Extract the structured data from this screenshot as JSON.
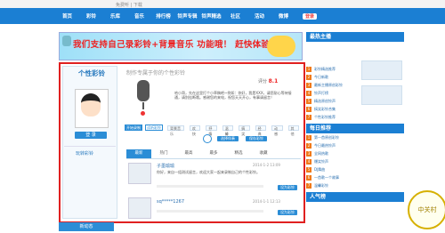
{
  "topbar": {
    "text": "免费听 | 下载"
  },
  "nav": {
    "items": [
      "首页",
      "彩铃",
      "乐库",
      "音乐",
      "排行榜",
      "铃声专辑",
      "铃声精选",
      "社区",
      "活动",
      "微博"
    ],
    "login": "登录"
  },
  "banner": {
    "headline": "我们支持自己录彩铃+背景音乐 功能哦！ 赶快体验吧！"
  },
  "sidebar": {
    "title": "个性彩铃",
    "login_label": "登 录",
    "link": "玩转彩铃"
  },
  "main": {
    "title": "制作专属于你的个性彩铃",
    "score_label": "评分",
    "score": "8.1",
    "description": "哈小哥，先在这里打个小草稿吧~例如：你好，我是XXX，请您耐心等待接通，请别挂断哦。感谢您的来电，祝您天天开心，有事请留言！",
    "buttons": {
      "record": "开始录制",
      "listen": "试听彩铃"
    },
    "tones": [
      "背景音乐",
      "欢快",
      "抒情",
      "温馨",
      "搞笑",
      "经典",
      "动感",
      "其他"
    ],
    "chips": [
      "选择伴奏",
      "保存彩铃"
    ],
    "tabs": [
      "最新",
      "热门",
      "最高",
      "最多",
      "精选",
      "收藏"
    ]
  },
  "comments": [
    {
      "user": "子墨瑜瑜",
      "date": "2014-1-2 13:09",
      "text": "你好，来自一组测试留言，欢迎大家一起来录制自己的个性彩铃。",
      "action": "设为彩铃"
    },
    {
      "user": "sq*****1267",
      "date": "2014-1-1 12:13",
      "text": "",
      "action": "设为彩铃"
    }
  ],
  "right": {
    "heads": [
      "最热主播",
      "每日推荐",
      "人气榜"
    ],
    "hot": [
      "彩铃精选推荐",
      "今日新歌",
      "最新主播原创彩铃",
      "铃声打榜",
      "精选原创铃声",
      "搞笑彩铃合集",
      "个性彩铃推荐"
    ],
    "daily": [
      "第一首原创彩铃",
      "今日最热铃声",
      "全网热歌",
      "爆笑铃声",
      "DJ舞曲",
      "一首歌一个故事",
      "温馨彩铃"
    ]
  },
  "footer": {
    "label": "新动态"
  },
  "watermark": {
    "text": "中关村"
  }
}
